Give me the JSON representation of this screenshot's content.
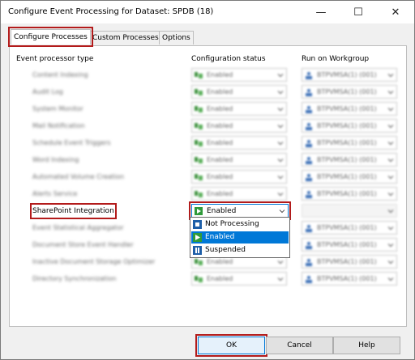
{
  "window": {
    "title": "Configure Event Processing for Dataset: SPDB (18)",
    "minimize_glyph": "—",
    "maximize_glyph": "☐",
    "close_glyph": "✕"
  },
  "tabs": [
    {
      "label": "Configure Processes",
      "active": true
    },
    {
      "label": "Custom Processes",
      "active": false
    },
    {
      "label": "Options",
      "active": false
    }
  ],
  "columns": {
    "processor": "Event processor type",
    "status": "Configuration status",
    "workgroup": "Run on Workgroup"
  },
  "rows": [
    {
      "label": "Content Indexing",
      "status": "Enabled",
      "workgroup": "BTPVMSA(1) (001)"
    },
    {
      "label": "Audit Log",
      "status": "Enabled",
      "workgroup": "BTPVMSA(1) (001)"
    },
    {
      "label": "System Monitor",
      "status": "Enabled",
      "workgroup": "BTPVMSA(1) (001)"
    },
    {
      "label": "Mail Notification",
      "status": "Enabled",
      "workgroup": "BTPVMSA(1) (001)"
    },
    {
      "label": "Schedule Event Triggers",
      "status": "Enabled",
      "workgroup": "BTPVMSA(1) (001)"
    },
    {
      "label": "Word Indexing",
      "status": "Enabled",
      "workgroup": "BTPVMSA(1) (001)"
    },
    {
      "label": "Automated Volume Creation",
      "status": "Enabled",
      "workgroup": "BTPVMSA(1) (001)"
    },
    {
      "label": "Alerts Service",
      "status": "Enabled",
      "workgroup": "BTPVMSA(1) (001)"
    },
    {
      "label": "SharePoint Integration",
      "status": "Enabled",
      "workgroup": ""
    },
    {
      "label": "Event Statistical Aggregator",
      "status": "Enabled",
      "workgroup": "BTPVMSA(1) (001)"
    },
    {
      "label": "Document Store Event Handler",
      "status": "Enabled",
      "workgroup": "BTPVMSA(1) (001)"
    },
    {
      "label": "Inactive Document Storage Optimizer",
      "status": "Enabled",
      "workgroup": "BTPVMSA(1) (001)"
    },
    {
      "label": "Directory Synchronization",
      "status": "Enabled",
      "workgroup": "BTPVMSA(1) (001)"
    }
  ],
  "dropdown": {
    "options": [
      "Not Processing",
      "Enabled",
      "Suspended"
    ],
    "selected": "Enabled"
  },
  "buttons": {
    "ok": "OK",
    "cancel": "Cancel",
    "help": "Help"
  },
  "colors": {
    "highlight": "#b31b1b",
    "selection": "#0078d7"
  }
}
